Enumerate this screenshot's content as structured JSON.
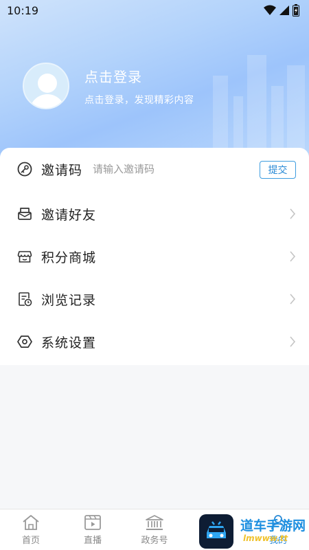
{
  "status_bar": {
    "time": "10:19"
  },
  "profile": {
    "login_title": "点击登录",
    "login_subtitle": "点击登录，发现精彩内容"
  },
  "invite": {
    "label": "邀请码",
    "placeholder": "请输入邀请码",
    "value": "",
    "submit_label": "提交"
  },
  "menu": {
    "items": [
      {
        "label": "邀请好友",
        "icon": "mail-icon"
      },
      {
        "label": "积分商城",
        "icon": "store-icon"
      },
      {
        "label": "浏览记录",
        "icon": "history-icon"
      },
      {
        "label": "系统设置",
        "icon": "settings-hex-icon"
      }
    ]
  },
  "tabbar": {
    "tabs": [
      {
        "label": "首页",
        "icon": "home-icon"
      },
      {
        "label": "直播",
        "icon": "live-video-icon"
      },
      {
        "label": "政务号",
        "icon": "government-icon"
      },
      {
        "label": "",
        "icon": "chat-icon"
      },
      {
        "label": "我的",
        "icon": "person-icon",
        "active": true
      }
    ]
  },
  "watermark": {
    "text": "道车手游网",
    "url": "lmwww.tt"
  },
  "colors": {
    "accent": "#2a8ad6",
    "header_gradient": [
      "#cfe3fb",
      "#9dc4fb"
    ]
  }
}
